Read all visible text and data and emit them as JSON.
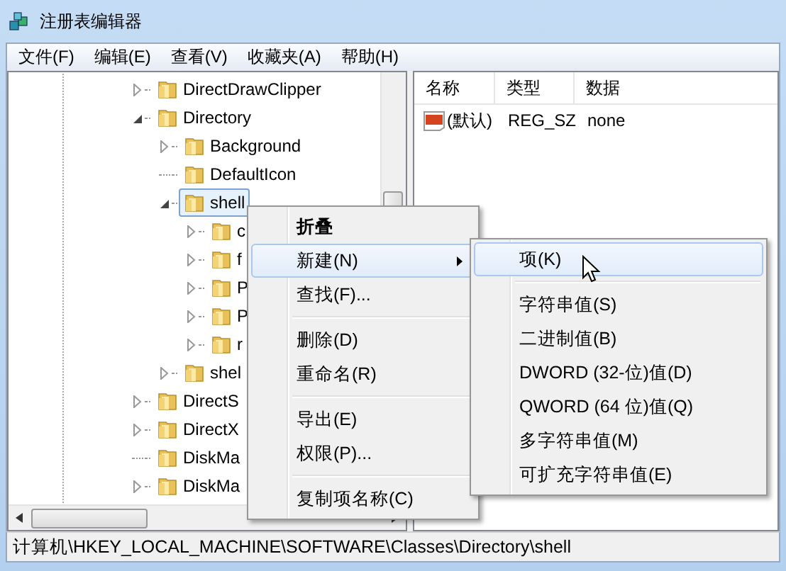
{
  "window": {
    "title": "注册表编辑器"
  },
  "menu_bar": [
    {
      "label": "文件(F)"
    },
    {
      "label": "编辑(E)"
    },
    {
      "label": "查看(V)"
    },
    {
      "label": "收藏夹(A)"
    },
    {
      "label": "帮助(H)"
    }
  ],
  "tree": [
    {
      "label": "DirectDrawClipper",
      "expanded": false,
      "selected": false
    },
    {
      "label": "Directory",
      "expanded": true,
      "selected": false,
      "children": [
        {
          "label": "Background",
          "expanded": false,
          "selected": false
        },
        {
          "label": "DefaultIcon",
          "leaf": true,
          "selected": false
        },
        {
          "label": "shell",
          "expanded": true,
          "selected": true,
          "children": [
            {
              "label": "c",
              "expanded": false,
              "selected": false
            },
            {
              "label": "f",
              "expanded": false,
              "selected": false
            },
            {
              "label": "P",
              "expanded": false,
              "selected": false
            },
            {
              "label": "P",
              "expanded": false,
              "selected": false
            },
            {
              "label": "r",
              "expanded": false,
              "selected": false
            }
          ]
        },
        {
          "label": "shel",
          "expanded": false,
          "selected": false
        }
      ]
    },
    {
      "label": "DirectS",
      "expanded": false,
      "selected": false
    },
    {
      "label": "DirectX",
      "expanded": false,
      "selected": false
    },
    {
      "label": "DiskMa",
      "leaf": true,
      "selected": false
    },
    {
      "label": "DiskMa",
      "expanded": false,
      "selected": false
    }
  ],
  "values": {
    "columns": [
      "名称",
      "类型",
      "数据"
    ],
    "rows": [
      {
        "name": "(默认)",
        "type": "REG_SZ",
        "data": "none"
      }
    ]
  },
  "context_menu": [
    {
      "kind": "item",
      "label": "折叠",
      "default": true,
      "selected": false
    },
    {
      "kind": "item",
      "label": "新建(N)",
      "submenu": true,
      "selected": true
    },
    {
      "kind": "item",
      "label": "查找(F)...",
      "selected": false
    },
    {
      "kind": "separator"
    },
    {
      "kind": "item",
      "label": "删除(D)",
      "selected": false
    },
    {
      "kind": "item",
      "label": "重命名(R)",
      "selected": false
    },
    {
      "kind": "separator"
    },
    {
      "kind": "item",
      "label": "导出(E)",
      "selected": false
    },
    {
      "kind": "item",
      "label": "权限(P)...",
      "selected": false
    },
    {
      "kind": "separator"
    },
    {
      "kind": "item",
      "label": "复制项名称(C)",
      "selected": false
    }
  ],
  "submenu": [
    {
      "kind": "item",
      "label": "项(K)",
      "selected": true
    },
    {
      "kind": "separator"
    },
    {
      "kind": "item",
      "label": "字符串值(S)",
      "selected": false
    },
    {
      "kind": "item",
      "label": "二进制值(B)",
      "selected": false
    },
    {
      "kind": "item",
      "label": "DWORD (32-位)值(D)",
      "selected": false
    },
    {
      "kind": "item",
      "label": "QWORD (64 位)值(Q)",
      "selected": false
    },
    {
      "kind": "item",
      "label": "多字符串值(M)",
      "selected": false
    },
    {
      "kind": "item",
      "label": "可扩充字符串值(E)",
      "selected": false
    }
  ],
  "status_bar": {
    "path": "计算机\\HKEY_LOCAL_MACHINE\\SOFTWARE\\Classes\\Directory\\shell"
  }
}
